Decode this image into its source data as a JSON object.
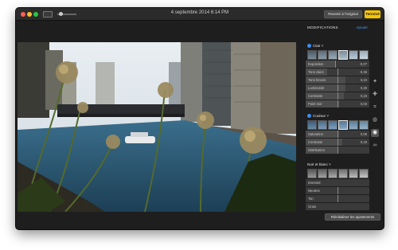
{
  "window": {
    "title": "4 septembre 2014 6:14 PM",
    "revert_label": "Revenir à l'original",
    "done_label": "Terminé"
  },
  "panel": {
    "title": "MODIFICATIONS",
    "add_label": "Ajouter",
    "reset_label": "Réinitialiser les ajustements",
    "sections": {
      "light": {
        "label": "Clair ˅",
        "sliders": [
          {
            "label": "Exposition",
            "value": "-0,07",
            "fill": 0.48,
            "mark": 0.46
          },
          {
            "label": "Tons clairs",
            "value": "-0,36",
            "fill": 0.34,
            "mark": 0.5
          },
          {
            "label": "Tons foncés",
            "value": "0,24",
            "fill": 0.62,
            "mark": 0.5
          },
          {
            "label": "Luminosité",
            "value": "0,26",
            "fill": 0.63,
            "mark": 0.5
          },
          {
            "label": "Contraste",
            "value": "0,23",
            "fill": 0.6,
            "mark": 0.5
          },
          {
            "label": "Point noir",
            "value": "0,03",
            "fill": 0.52,
            "mark": 0.5
          }
        ]
      },
      "color": {
        "label": "Couleur ˅",
        "sliders": [
          {
            "label": "Saturation",
            "value": "0,06",
            "fill": 0.53,
            "mark": 0.5
          },
          {
            "label": "Contraste",
            "value": "0,18",
            "fill": 0.58,
            "mark": 0.5
          },
          {
            "label": "Distribution",
            "value": "",
            "fill": 0.5,
            "mark": 0.5
          }
        ]
      },
      "bw": {
        "label": "Noir et blanc ˅",
        "sliders": [
          {
            "label": "Intensité",
            "value": "",
            "fill": 0.0,
            "mark": 0.0
          },
          {
            "label": "Neutres",
            "value": "",
            "fill": 0.0,
            "mark": 0.5
          },
          {
            "label": "Ton",
            "value": "",
            "fill": 0.0,
            "mark": 0.5
          },
          {
            "label": "Grain",
            "value": "",
            "fill": 0.0,
            "mark": 0.0
          }
        ]
      }
    }
  },
  "tools": [
    "magic-wand-icon",
    "bandage-icon",
    "crop-icon",
    "filters-icon",
    "adjust-icon",
    "link-icon"
  ],
  "colors": {
    "accent": "#3b8ff0",
    "done_button": "#f5c400",
    "window_bg": "#1e1e1e"
  }
}
